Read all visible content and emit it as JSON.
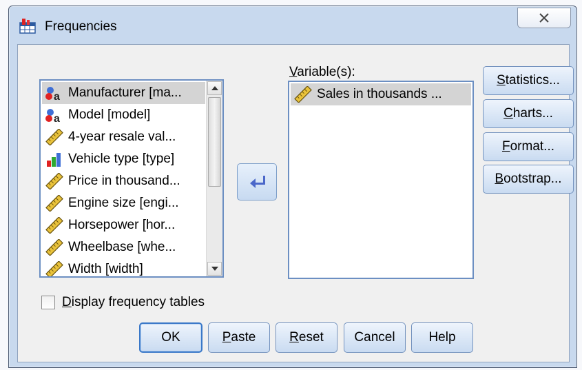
{
  "window": {
    "title": "Frequencies",
    "title_icon": "frequencies-table-icon",
    "close_icon": "close-x-icon"
  },
  "source_list": {
    "items": [
      {
        "label": "Manufacturer [ma...",
        "icon": "nominal-string-icon",
        "selected": true
      },
      {
        "label": "Model [model]",
        "icon": "nominal-string-icon",
        "selected": false
      },
      {
        "label": "4-year resale val...",
        "icon": "scale-ruler-icon",
        "selected": false
      },
      {
        "label": "Vehicle type [type]",
        "icon": "ordinal-bars-icon",
        "selected": false
      },
      {
        "label": "Price in thousand...",
        "icon": "scale-ruler-icon",
        "selected": false
      },
      {
        "label": "Engine size [engi...",
        "icon": "scale-ruler-icon",
        "selected": false
      },
      {
        "label": "Horsepower [hor...",
        "icon": "scale-ruler-icon",
        "selected": false
      },
      {
        "label": "Wheelbase [whe...",
        "icon": "scale-ruler-icon",
        "selected": false
      },
      {
        "label": "Width [width]",
        "icon": "scale-ruler-icon",
        "selected": false
      }
    ]
  },
  "move_button": {
    "icon": "arrow-left-icon"
  },
  "variables": {
    "label_prefix": "",
    "label_access": "V",
    "label_rest": "ariable(s):",
    "items": [
      {
        "label": "Sales in thousands ...",
        "icon": "scale-ruler-icon",
        "selected": true
      }
    ]
  },
  "side_buttons": [
    {
      "access": "S",
      "rest": "tatistics..."
    },
    {
      "access": "C",
      "rest": "harts..."
    },
    {
      "access": "F",
      "rest": "ormat..."
    },
    {
      "access": "B",
      "rest": "ootstrap..."
    }
  ],
  "checkbox": {
    "access": "D",
    "rest": "isplay frequency tables",
    "checked": false
  },
  "bottom_buttons": [
    {
      "label": "OK"
    },
    {
      "access": "P",
      "rest": "aste"
    },
    {
      "access": "R",
      "rest": "eset"
    },
    {
      "label": "Cancel"
    },
    {
      "label": "Help"
    }
  ],
  "colors": {
    "window_frame": "#c8d9ee",
    "list_border": "#6c8fc2",
    "selection": "#d4d4d4",
    "button_top": "#eef4fc",
    "button_bottom": "#c9dbf1"
  }
}
